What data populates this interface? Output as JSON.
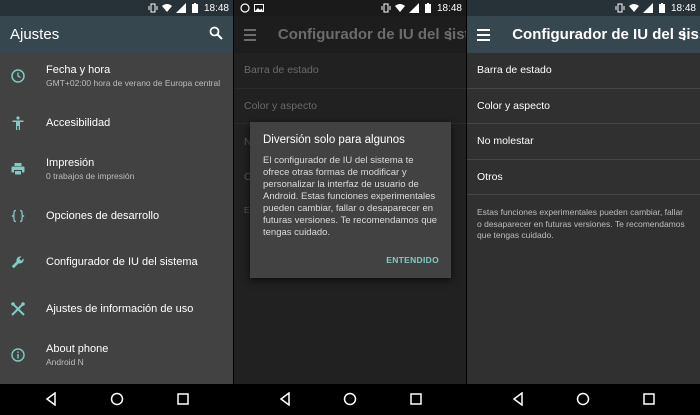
{
  "status_time": "18:48",
  "screen1": {
    "title": "Ajustes",
    "items": [
      {
        "icon": "clock-icon",
        "label": "Fecha y hora",
        "sub": "GMT+02:00 hora de verano de Europa central"
      },
      {
        "icon": "accessibility-icon",
        "label": "Accesibilidad",
        "sub": ""
      },
      {
        "icon": "print-icon",
        "label": "Impresión",
        "sub": "0 trabajos de impresión"
      },
      {
        "icon": "braces-icon",
        "label": "Opciones de desarrollo",
        "sub": ""
      },
      {
        "icon": "wrench-icon",
        "label": "Configurador de IU del sistema",
        "sub": ""
      },
      {
        "icon": "tools-icon",
        "label": "Ajustes de información de uso",
        "sub": ""
      },
      {
        "icon": "info-icon",
        "label": "About phone",
        "sub": "Android N"
      }
    ]
  },
  "screen2": {
    "title": "Configurador de IU del sistema",
    "items": [
      "Barra de estado",
      "Color y aspecto"
    ],
    "partial_n": "N",
    "partial_o": "O",
    "partial_e": "E",
    "dialog": {
      "title": "Diversión solo para algunos",
      "body": "El configurador de IU del sistema te ofrece otras formas de modificar y personalizar la interfaz de usuario de Android. Estas funciones experimentales pueden cambiar, fallar o desaparecer en futuras versiones. Te recomendamos que tengas cuidado.",
      "button": "ENTENDIDO"
    }
  },
  "screen3": {
    "title": "Configurador de IU del sis...",
    "items": [
      "Barra de estado",
      "Color y aspecto",
      "No molestar",
      "Otros"
    ],
    "note": "Estas funciones experimentales pueden cambiar, fallar o desaparecer en futuras versiones. Te recomendamos que tengas cuidado."
  },
  "colors": {
    "accent": "#80cbc4",
    "toolbar": "#37474f",
    "statusbar": "#263238"
  }
}
